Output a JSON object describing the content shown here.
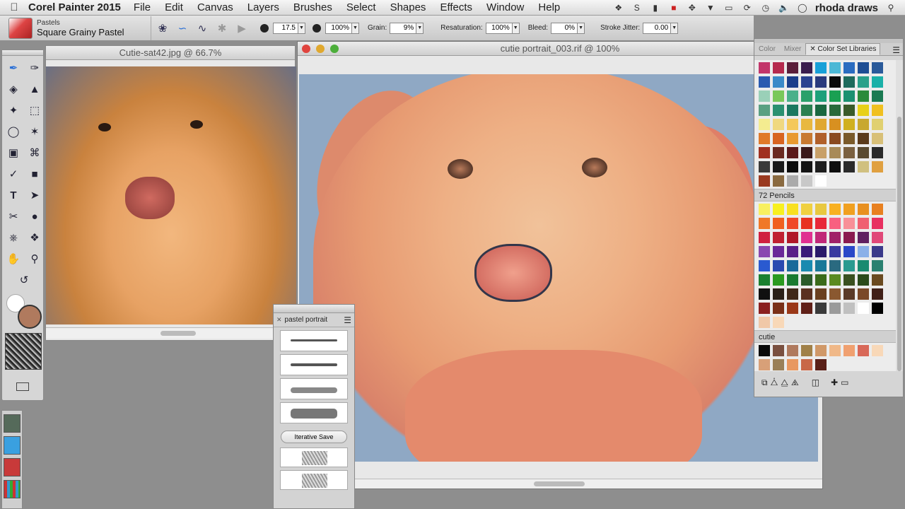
{
  "menubar": {
    "app_name": "Corel Painter 2015",
    "menus": [
      "File",
      "Edit",
      "Canvas",
      "Layers",
      "Brushes",
      "Select",
      "Shapes",
      "Effects",
      "Window",
      "Help"
    ],
    "user": "rhoda draws"
  },
  "propbar": {
    "brush_category": "Pastels",
    "brush_variant": "Square Grainy Pastel",
    "size": "17.5",
    "opacity": "100%",
    "grain_label": "Grain:",
    "grain": "9%",
    "resaturation_label": "Resaturation:",
    "resaturation": "100%",
    "bleed_label": "Bleed:",
    "bleed": "0%",
    "jitter_label": "Stroke Jitter:",
    "jitter": "0.00"
  },
  "photo_window": {
    "title": "Cutie-sat42.jpg @ 66.7%"
  },
  "paint_window": {
    "title": "cutie portrait_003.rif @ 100%"
  },
  "brush_library": {
    "name": "pastel portrait",
    "iterative_save_label": "Iterative Save"
  },
  "color_panel": {
    "tabs": [
      "Color",
      "Mixer",
      "Color Set Libraries"
    ],
    "libraries": [
      "72 Pencils",
      "cutie"
    ]
  },
  "colors": {
    "main_color": "#b07a5e",
    "secondary_color": "#ffffff",
    "canvas_bg": "#8fa8c4",
    "top_set": [
      "#c2366a",
      "#b52a4e",
      "#5a1e3a",
      "#3a1d4e",
      "#18a0d8",
      "#4cb8d6",
      "#2a6cc0",
      "#1e4e94",
      "#2a5a9a",
      "#2a5ab0",
      "#3a8ac8",
      "#1a3e8a",
      "#2a4290",
      "#2a3a7c",
      "#0a0a0a",
      "#1e6a5c",
      "#2aa08a",
      "#1ab0a8",
      "#9ad0b8",
      "#7ac85a",
      "#4ab08a",
      "#2aa06a",
      "#1ea07a",
      "#1aa052",
      "#1a9070",
      "#2a8a3a",
      "#1a7a52",
      "#5aa082",
      "#2a9070",
      "#1a7860",
      "#2a8050",
      "#1a6840",
      "#2a6a3a",
      "#3a5a2a",
      "#e8d018",
      "#f0c020",
      "#f4ec90",
      "#f0d880",
      "#f4c85a",
      "#e8b840",
      "#e0a830",
      "#d89020",
      "#d0b020",
      "#c8a830",
      "#e0d070",
      "#e07a2a",
      "#d86420",
      "#e89a30",
      "#c87a30",
      "#b0602a",
      "#8a4a20",
      "#7a5a2a",
      "#5a3a1a",
      "#d8c078",
      "#a03020",
      "#6a2a20",
      "#5a1a1a",
      "#3a1a1a",
      "#c8a068",
      "#a88a58",
      "#7a6040",
      "#5a4a30",
      "#2a2a2a",
      "#3a3a3a",
      "#1a1a1a",
      "#0a0a0a",
      "#141414",
      "#1e1e1e",
      "#0e0e0e",
      "#2a2a2a",
      "#d0c080",
      "#e0a040",
      "#9a3a20",
      "#8a6a40",
      "#aaaaaa",
      "#c8c8c8",
      "#ffffff",
      "#ececec",
      "#ececec",
      "#ececec",
      "#ececec"
    ],
    "pencils": [
      "#f8f060",
      "#f8f020",
      "#f8e020",
      "#f0d040",
      "#e8c840",
      "#f8b020",
      "#f0a020",
      "#e89020",
      "#e88020",
      "#f07828",
      "#f06020",
      "#f04828",
      "#e83020",
      "#e82838",
      "#f86080",
      "#f89098",
      "#f06070",
      "#e83060",
      "#d02040",
      "#c02030",
      "#b01828",
      "#e03090",
      "#c02878",
      "#a02068",
      "#8a1a50",
      "#602060",
      "#e04878",
      "#8a48b0",
      "#6a2898",
      "#5a2088",
      "#3a1a78",
      "#2a1a6a",
      "#3a3aa0",
      "#2a48c8",
      "#8ab0e8",
      "#3a3a8a",
      "#2a5ad0",
      "#2a4ab0",
      "#1a6a9a",
      "#1a8ab0",
      "#1a7898",
      "#2a6a80",
      "#2a9a90",
      "#1a8a70",
      "#2a8070",
      "#1a8030",
      "#2a9a20",
      "#1a7a30",
      "#2a5a2a",
      "#3a6a1a",
      "#5a8a20",
      "#3a5020",
      "#2a4a1a",
      "#6a4a20",
      "#101010",
      "#2a2018",
      "#402818",
      "#5a3020",
      "#6a4020",
      "#8a5830",
      "#5a3a28",
      "#7a4828",
      "#402018",
      "#8a2020",
      "#7a3018",
      "#9a3818",
      "#602018",
      "#3a3a3a",
      "#9a9a9a",
      "#c0c0c0",
      "#ffffff",
      "#000000",
      "#f0c8a8",
      "#f8d8b8"
    ],
    "cutie": [
      "#0a0a0a",
      "#7a5040",
      "#b07a5e",
      "#a08048",
      "#d09868",
      "#f0b888",
      "#f0a070",
      "#d86858",
      "#f8d8b8",
      "#d8a078",
      "#9a8058",
      "#e89860",
      "#c86848",
      "#5a2018"
    ]
  }
}
